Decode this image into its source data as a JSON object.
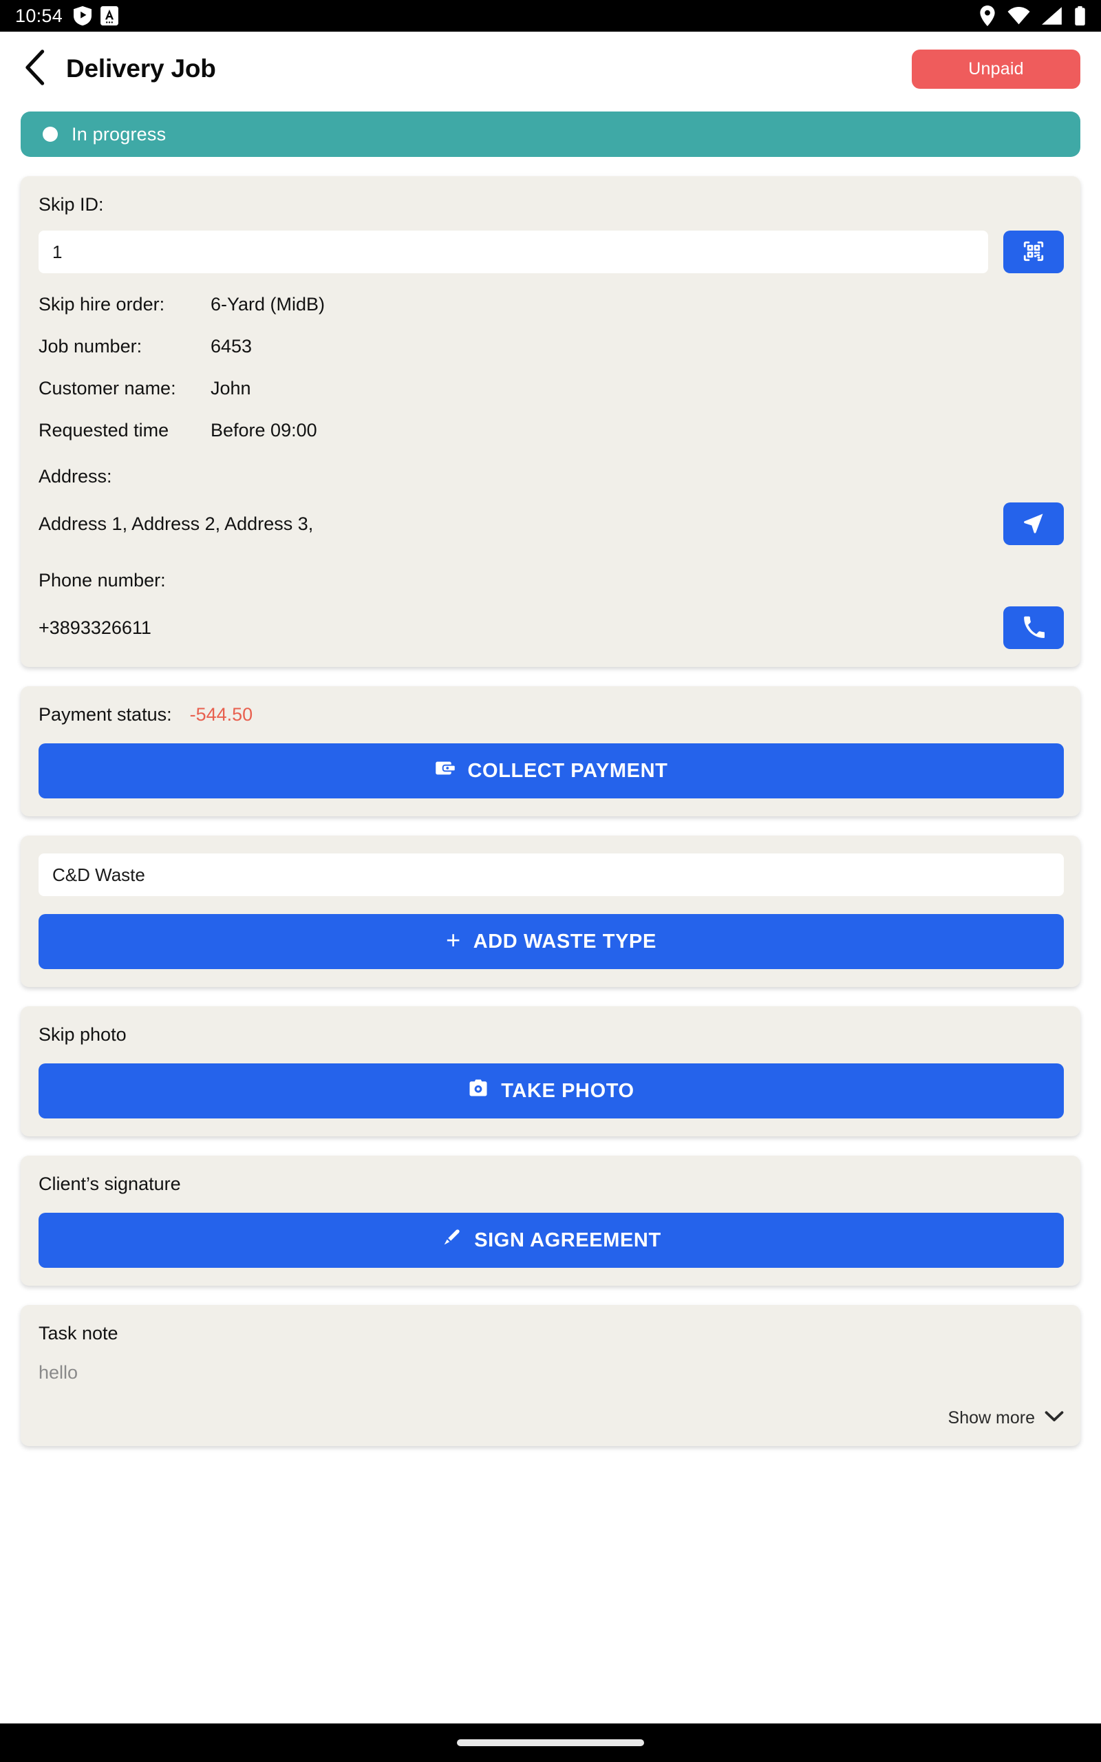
{
  "status_bar": {
    "time": "10:54",
    "left_icons": [
      "shield-play-icon",
      "app-a-icon"
    ],
    "right_icons": [
      "location-pin-icon",
      "wifi-icon",
      "cellular-signal-icon",
      "battery-icon"
    ]
  },
  "appbar": {
    "back_icon": "chevron-left-icon",
    "title": "Delivery Job",
    "badge_label": "Unpaid",
    "badge_color": "#ef5c5c"
  },
  "status_banner": {
    "text": "In progress",
    "color": "#3fa9a6",
    "dot": "status-dot"
  },
  "skip_card": {
    "skip_id_label": "Skip ID:",
    "skip_id_value": "1",
    "skip_id_placeholder": "Skip ID",
    "scan_icon": "qr-code-scan-icon",
    "details": [
      {
        "key": "Skip hire order:",
        "value": "6-Yard (MidB)"
      },
      {
        "key": "Job number:",
        "value": "6453"
      },
      {
        "key": "Customer name:",
        "value": "John"
      },
      {
        "key": "Requested time",
        "value": "Before 09:00"
      }
    ],
    "address_label": "Address:",
    "address_value": "Address 1, Address 2, Address 3,",
    "navigate_icon": "navigation-arrow-icon",
    "phone_label": "Phone number:",
    "phone_value": "+3893326611",
    "call_icon": "phone-handset-icon"
  },
  "payment_card": {
    "status_label": "Payment status:",
    "amount": "-544.50",
    "amount_color": "#e8604f",
    "button_label": "COLLECT PAYMENT",
    "button_icon": "wallet-icon"
  },
  "waste_card": {
    "waste_type_value": "C&D Waste",
    "waste_type_placeholder": "Waste type",
    "add_button_label": "ADD WASTE TYPE",
    "add_button_icon": "plus-icon"
  },
  "photo_card": {
    "title": "Skip photo",
    "button_label": "TAKE PHOTO",
    "button_icon": "camera-icon"
  },
  "signature_card": {
    "title": "Client’s signature",
    "button_label": "SIGN AGREEMENT",
    "button_icon": "pen-edit-icon"
  },
  "note_card": {
    "title": "Task note",
    "note": "hello",
    "show_more_label": "Show more",
    "show_more_icon": "chevron-down-icon"
  },
  "navbar": {
    "home_indicator": "home-gesture-pill"
  }
}
